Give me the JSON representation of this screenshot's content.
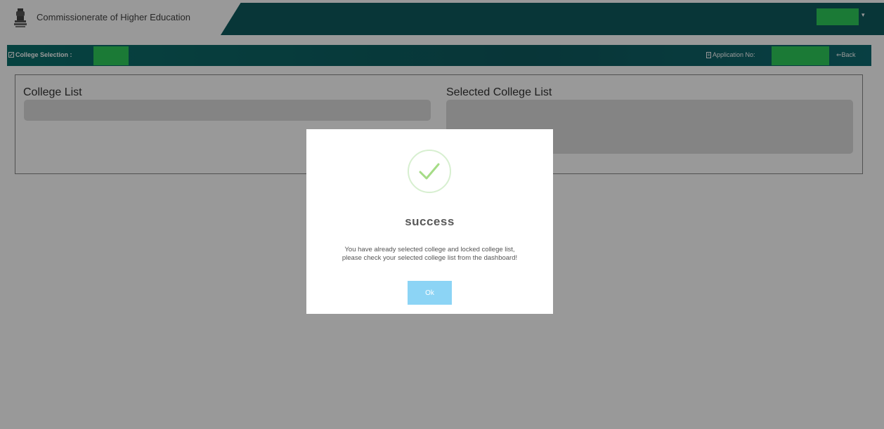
{
  "header": {
    "title": "Commissionerate of Higher Education",
    "user_caret": "▾",
    "emblem_icon": "state-emblem-icon"
  },
  "selection_bar": {
    "college_selection_label": "College Selection :",
    "application_label": "Application No:",
    "back_label": "Back",
    "icons": {
      "college": "edit-icon",
      "application": "document-icon",
      "back": "back-arrow-icon"
    }
  },
  "lists": {
    "college_list_title": "College List",
    "selected_college_list_title": "Selected College List"
  },
  "modal": {
    "title": "success",
    "message_line1": "You have already selected college and locked college list,",
    "message_line2": "please check your selected college list from the dashboard!",
    "ok_label": "Ok",
    "icon": "success-check-icon"
  },
  "colors": {
    "header_band": "#0e5a5e",
    "redaction_green": "#2ecc5a",
    "ok_button": "#8cd4f5",
    "success_check": "#a5dc86",
    "overlay": "rgba(0,0,0,0.4)"
  }
}
